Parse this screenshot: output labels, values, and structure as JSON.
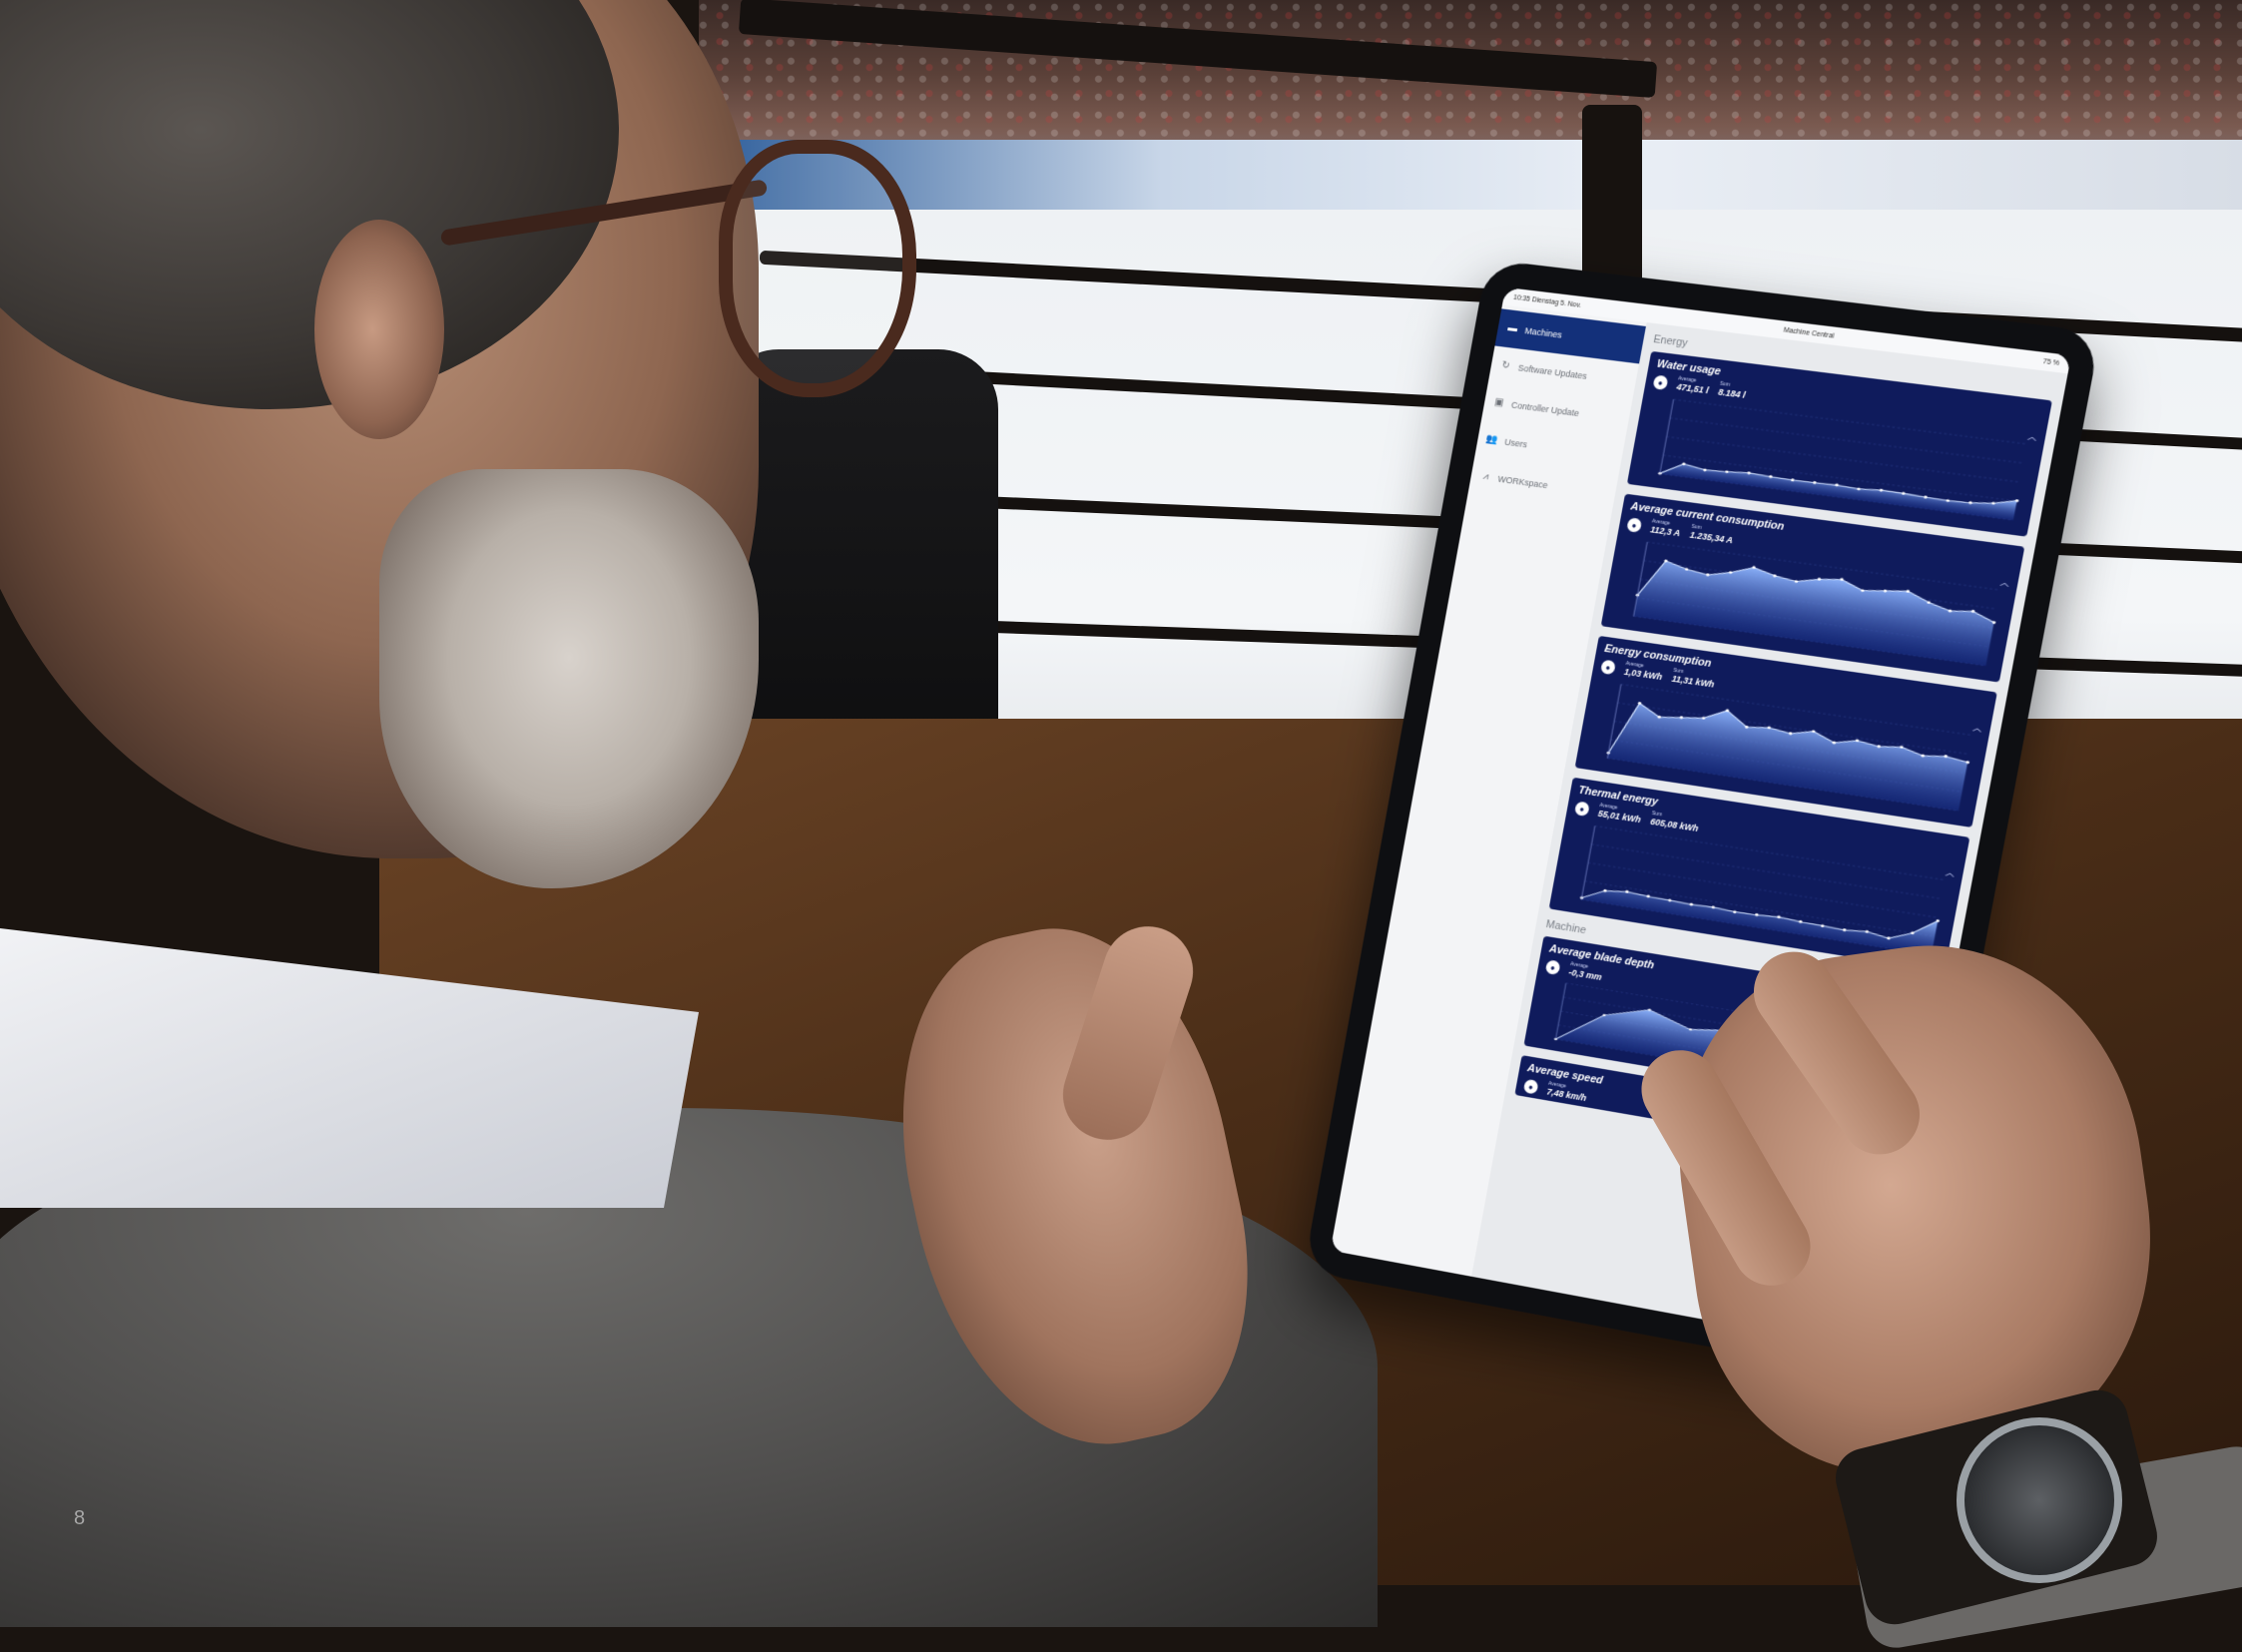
{
  "page_number": "8",
  "tablet": {
    "status_left": "10:35  Dienstag 5. Nov.",
    "status_center": "...",
    "status_right": "75 %",
    "url": "Machine Central",
    "sidebar": [
      {
        "label": "Machines",
        "icon": "machine-icon",
        "active": true
      },
      {
        "label": "Software Updates",
        "icon": "refresh-icon",
        "active": false
      },
      {
        "label": "Controller Update",
        "icon": "chip-icon",
        "active": false
      },
      {
        "label": "Users",
        "icon": "users-icon",
        "active": false
      },
      {
        "label": "WORKspace",
        "icon": "chart-icon",
        "active": false
      }
    ],
    "sections": {
      "energy": "Energy",
      "machine": "Machine"
    },
    "labels": {
      "average": "Average",
      "sum": "Sum"
    },
    "cards": [
      {
        "title": "Water usage",
        "icon": "drop-icon",
        "avg": "471,51 l",
        "sum": "8.184 l"
      },
      {
        "title": "Average current consumption",
        "icon": "current-icon",
        "avg": "112,3 A",
        "sum": "1.235,34 A"
      },
      {
        "title": "Energy consumption",
        "icon": "bolt-icon",
        "avg": "1,03 kWh",
        "sum": "11,31 kWh"
      },
      {
        "title": "Thermal energy",
        "icon": "thermo-icon",
        "avg": "55,01 kWh",
        "sum": "605,08 kWh"
      },
      {
        "title": "Average blade depth",
        "icon": "blade-icon",
        "avg": "-0,3 mm",
        "sum": ""
      },
      {
        "title": "Average speed",
        "icon": "speed-icon",
        "avg": "7,48 km/h",
        "sum": ""
      }
    ],
    "charts": [
      {
        "type": "area",
        "series": [
          {
            "values": [
              10,
              240,
              180,
              200,
              230,
              215,
              205,
              210,
              220,
              200,
              230,
              225,
              210,
              200,
              215,
              260,
              360
            ]
          }
        ],
        "ylim": [
          0,
          1400
        ]
      },
      {
        "type": "area",
        "series": [
          {
            "values": [
              40,
              110,
              100,
              95,
              105,
              120,
              110,
              105,
              115,
              120,
              105,
              110,
              115,
              100,
              90,
              95,
              80
            ]
          }
        ],
        "ylim": [
          0,
          140
        ]
      },
      {
        "type": "area",
        "series": [
          {
            "values": [
              0.1,
              1.1,
              0.9,
              0.95,
              1.0,
              1.2,
              0.95,
              1.0,
              0.95,
              1.05,
              0.9,
              1.0,
              0.95,
              1.0,
              0.9,
              0.95,
              0.9
            ]
          }
        ],
        "ylim": [
          0,
          1.4
        ]
      },
      {
        "type": "area",
        "series": [
          {
            "values": [
              3,
              20,
              24,
              22,
              21,
              20,
              21,
              19,
              20,
              22,
              20,
              19,
              18,
              21,
              16,
              30,
              55
            ]
          }
        ],
        "ylim": [
          0,
          120
        ]
      },
      {
        "type": "area",
        "series": [
          {
            "values": [
              -0.6,
              -0.1,
              0.1,
              -0.1,
              0.0,
              0.1,
              -0.1,
              0.0,
              0.05
            ]
          }
        ],
        "ylim": [
          -0.6,
          0.3
        ]
      }
    ]
  }
}
